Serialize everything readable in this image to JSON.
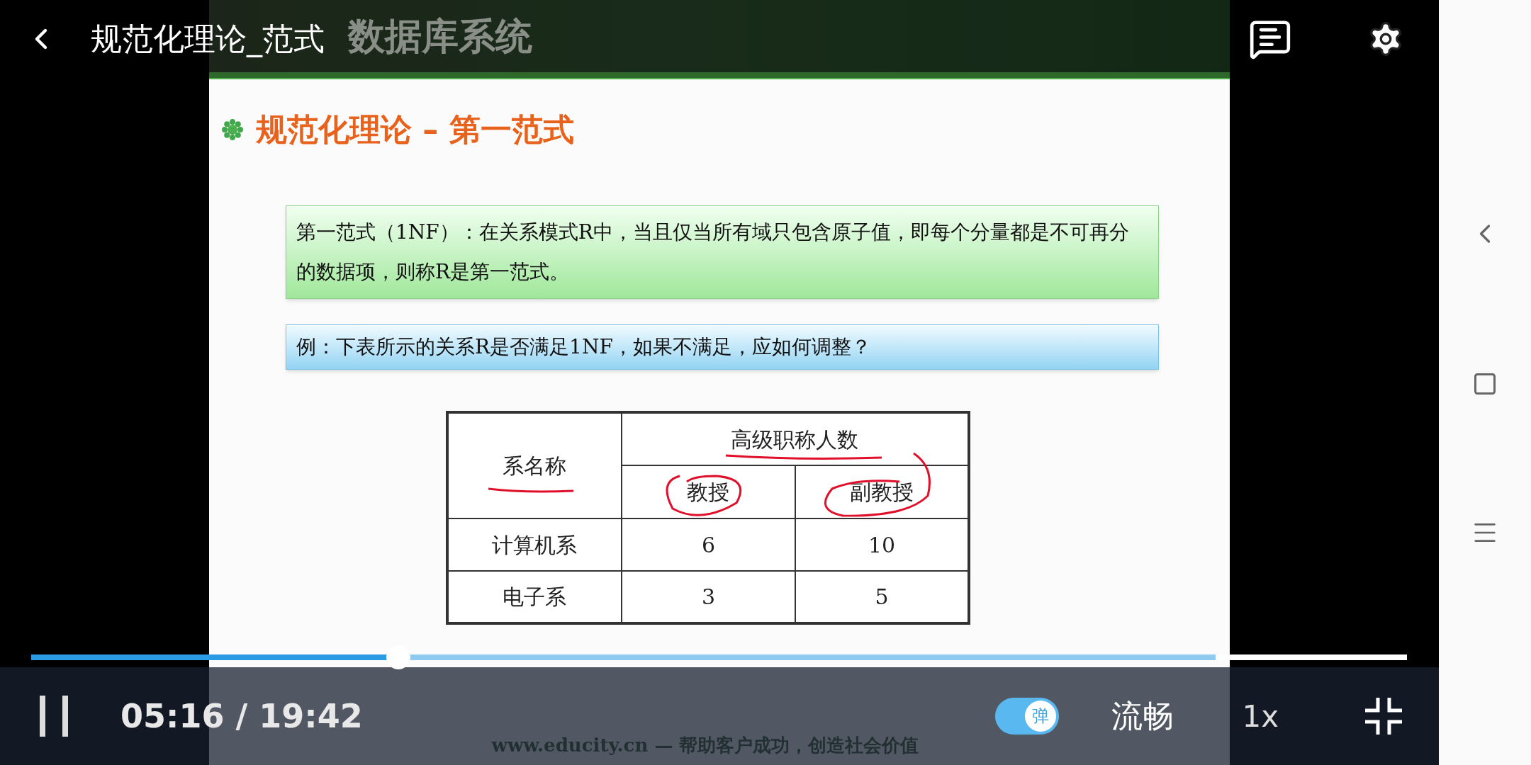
{
  "player": {
    "title": "规范化理论_范式",
    "time": "05:16 / 19:42",
    "progress": {
      "level": 0.267
    },
    "buffered": {
      "level": 0.861
    },
    "playing": true,
    "danmaku": {
      "label": "弹",
      "on": true
    },
    "quality": "流畅",
    "speed": "1x"
  },
  "slide": {
    "header": "数据库系统",
    "title": "规范化理论 – 第一范式",
    "definition": "第一范式（1NF）：在关系模式R中，当且仅当所有域只包含原子值，即每个分量都是不可再分的数据项，则称R是第一范式。",
    "question": "例：下表所示的关系R是否满足1NF，如果不满足，应如何调整？",
    "table": {
      "row_header": "系名称",
      "group_header": "高级职称人数",
      "sub_headers": [
        "教授",
        "副教授"
      ],
      "rows": [
        [
          "计算机系",
          "6",
          "10"
        ],
        [
          "电子系",
          "3",
          "5"
        ]
      ]
    },
    "footer": "www.educity.cn — 帮助客户成功，创造社会价值"
  }
}
